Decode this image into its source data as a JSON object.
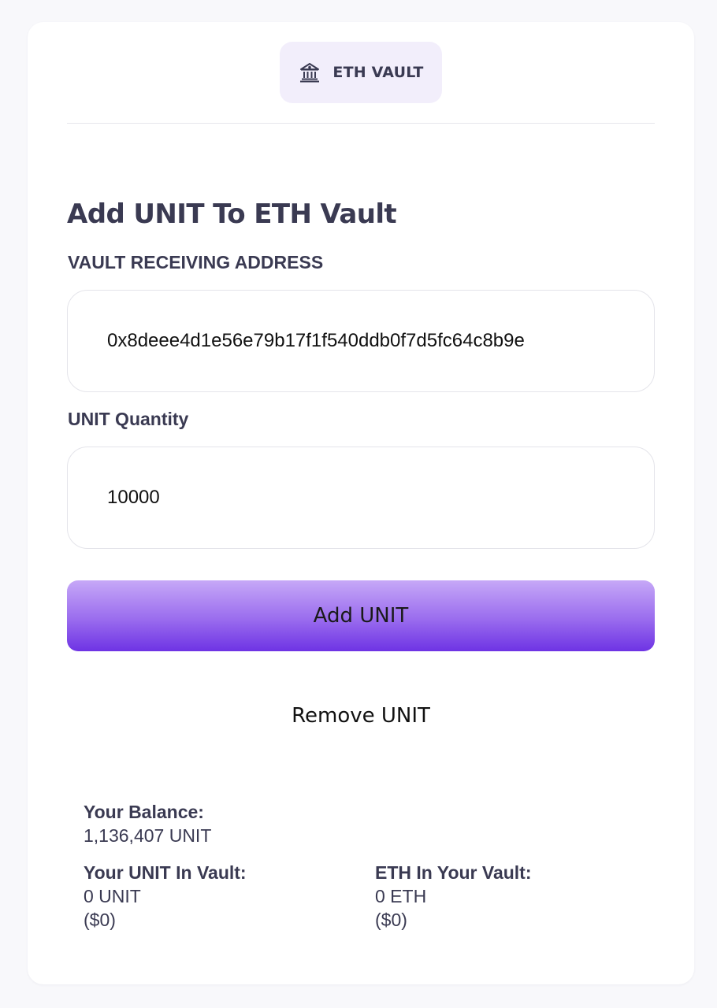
{
  "header": {
    "tab_label": "ETH VAULT",
    "tab_icon": "bank-icon"
  },
  "main": {
    "title": "Add UNIT To ETH Vault",
    "address_label": "VAULT RECEIVING ADDRESS",
    "address_value": "0x8deee4d1e56e79b17f1f540ddb0f7d5fc64c8b9e",
    "quantity_label": "UNIT Quantity",
    "quantity_value": "10000",
    "add_button_label": "Add UNIT",
    "remove_link_label": "Remove UNIT"
  },
  "stats": {
    "balance_label": "Your Balance:",
    "balance_value": "1,136,407 UNIT",
    "unit_in_vault_label": "Your UNIT In Vault:",
    "unit_in_vault_value": "0 UNIT",
    "unit_in_vault_usd": "($0)",
    "eth_in_vault_label": "ETH In Your Vault:",
    "eth_in_vault_value": "0 ETH",
    "eth_in_vault_usd": "($0)"
  },
  "colors": {
    "accent_gradient_top": "#c6a8f7",
    "accent_gradient_bottom": "#6e33e4",
    "tab_background": "#f2eefb",
    "text_dark": "#3a3a52"
  }
}
